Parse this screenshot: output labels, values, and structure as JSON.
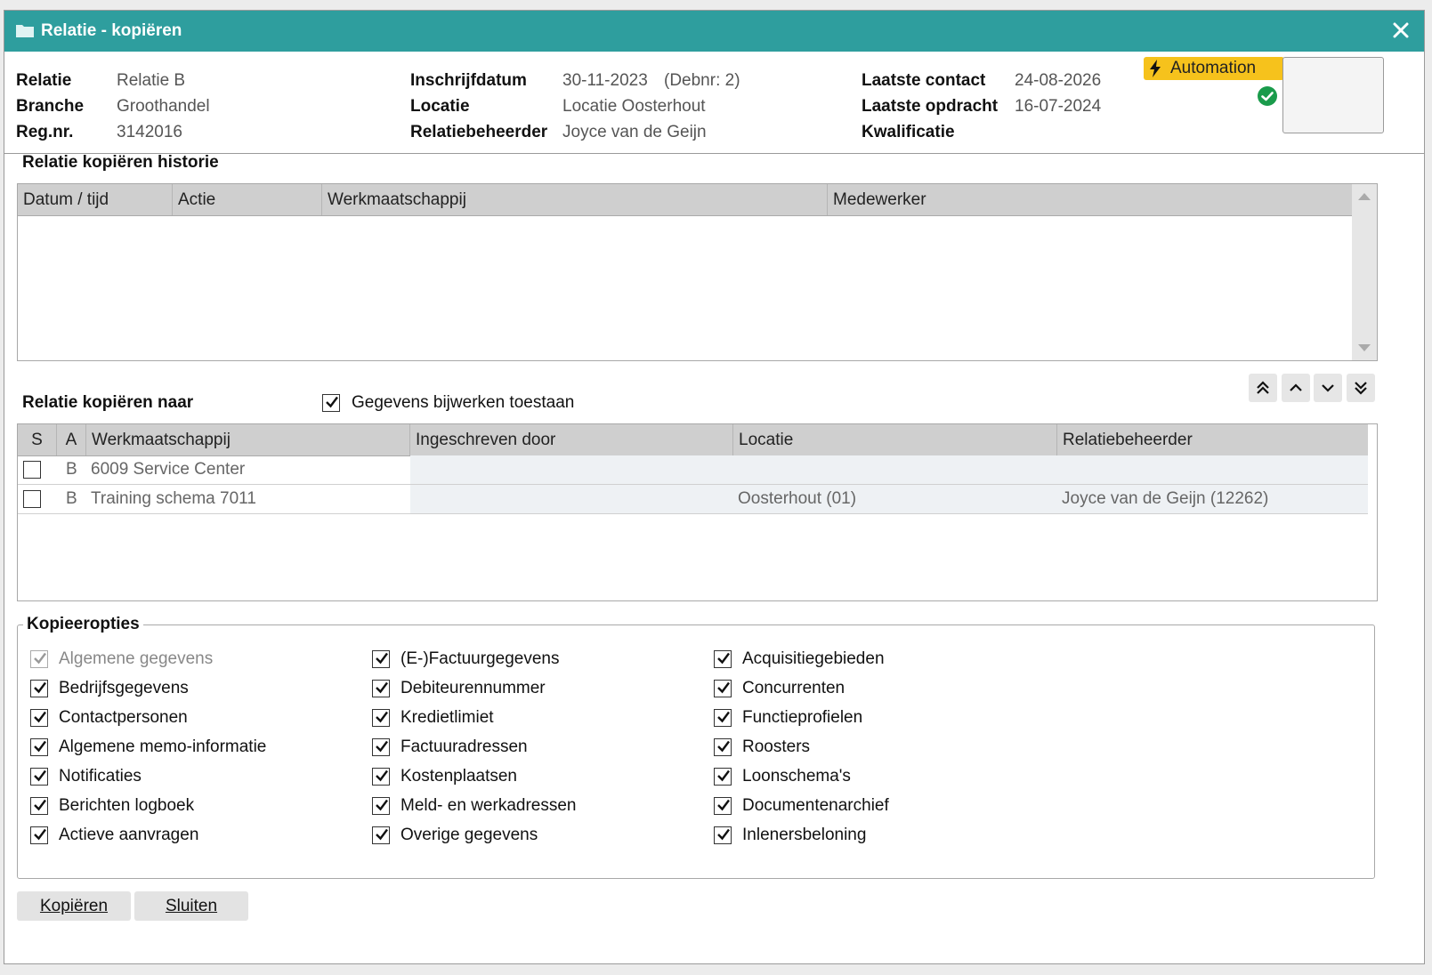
{
  "window": {
    "title": "Relatie - kopiëren"
  },
  "header": {
    "relatie_label": "Relatie",
    "relatie_value": "Relatie B",
    "branche_label": "Branche",
    "branche_value": "Groothandel",
    "regnr_label": "Reg.nr.",
    "regnr_value": "3142016",
    "inschrijfdatum_label": "Inschrijfdatum",
    "inschrijfdatum_value": "30-11-2023",
    "debnr_value": "(Debnr: 2)",
    "locatie_label": "Locatie",
    "locatie_value": "Locatie Oosterhout",
    "relatiebeheerder_label": "Relatiebeheerder",
    "relatiebeheerder_value": "Joyce van de Geijn",
    "laatste_contact_label": "Laatste contact",
    "laatste_contact_value": "24-08-2026",
    "laatste_opdracht_label": "Laatste opdracht",
    "laatste_opdracht_value": "16-07-2024",
    "kwalificatie_label": "Kwalificatie",
    "automation_label": "Automation"
  },
  "history": {
    "title": "Relatie kopiëren historie",
    "columns": [
      "Datum / tijd",
      "Actie",
      "Werkmaatschappij",
      "Medewerker"
    ]
  },
  "copyto": {
    "title": "Relatie kopiëren naar",
    "allow_update_label": "Gegevens bijwerken toestaan",
    "allow_update_checked": true,
    "columns": [
      "S",
      "A",
      "Werkmaatschappij",
      "Ingeschreven door",
      "Locatie",
      "Relatiebeheerder"
    ],
    "rows": [
      {
        "s": false,
        "a": "B",
        "werkmaatschappij": "6009 Service Center",
        "ingeschreven_door": "",
        "locatie": "",
        "relatiebeheerder": ""
      },
      {
        "s": false,
        "a": "B",
        "werkmaatschappij": "Training schema 7011",
        "ingeschreven_door": "",
        "locatie": "Oosterhout (01)",
        "relatiebeheerder": "Joyce van de Geijn (12262)"
      }
    ]
  },
  "options": {
    "title": "Kopieeropties",
    "col1": [
      {
        "label": "Algemene gegevens",
        "checked": true,
        "disabled": true
      },
      {
        "label": "Bedrijfsgegevens",
        "checked": true
      },
      {
        "label": "Contactpersonen",
        "checked": true
      },
      {
        "label": "Algemene memo-informatie",
        "checked": true
      },
      {
        "label": "Notificaties",
        "checked": true
      },
      {
        "label": "Berichten logboek",
        "checked": true
      },
      {
        "label": "Actieve aanvragen",
        "checked": true
      }
    ],
    "col2": [
      {
        "label": "(E-)Factuurgegevens",
        "checked": true
      },
      {
        "label": "Debiteurennummer",
        "checked": true
      },
      {
        "label": "Kredietlimiet",
        "checked": true
      },
      {
        "label": "Factuuradressen",
        "checked": true
      },
      {
        "label": "Kostenplaatsen",
        "checked": true
      },
      {
        "label": "Meld- en werkadressen",
        "checked": true
      },
      {
        "label": "Overige gegevens",
        "checked": true
      }
    ],
    "col3": [
      {
        "label": "Acquisitiegebieden",
        "checked": true
      },
      {
        "label": "Concurrenten",
        "checked": true
      },
      {
        "label": "Functieprofielen",
        "checked": true
      },
      {
        "label": "Roosters",
        "checked": true
      },
      {
        "label": "Loonschema's",
        "checked": true
      },
      {
        "label": "Documentenarchief",
        "checked": true
      },
      {
        "label": "Inlenersbeloning",
        "checked": true
      }
    ]
  },
  "buttons": {
    "copy_label": "Kopiëren",
    "close_label": "Sluiten"
  },
  "colors": {
    "titlebar": "#2e9e9e",
    "automation_badge": "#f6c21c",
    "ok": "#1a9b4b"
  },
  "icons": {
    "folder": "folder-icon",
    "close": "close-icon",
    "bolt": "bolt-icon",
    "ok": "check-circle-icon"
  }
}
